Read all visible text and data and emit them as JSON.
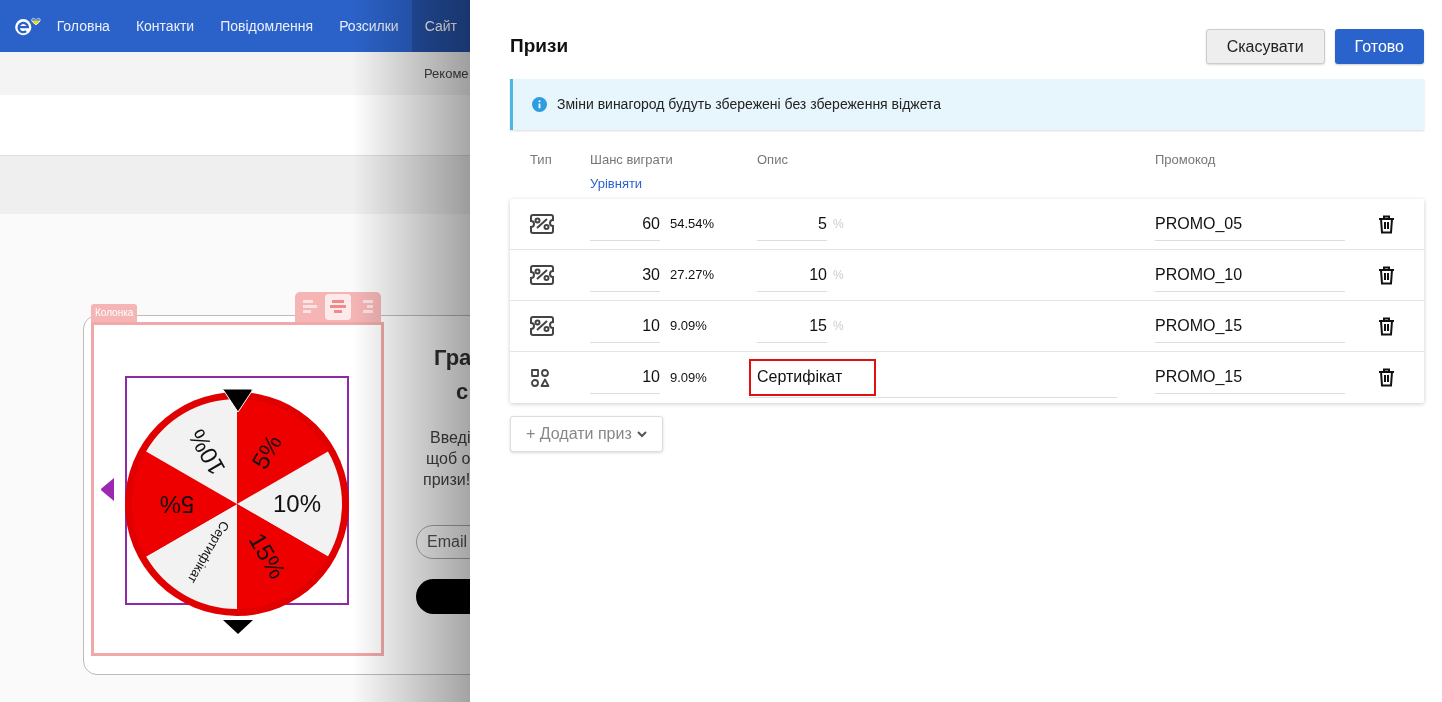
{
  "nav": {
    "items": [
      {
        "label": "Головна",
        "selected": false
      },
      {
        "label": "Контакти",
        "selected": false
      },
      {
        "label": "Повідомлення",
        "selected": false
      },
      {
        "label": "Розсилки",
        "selected": false
      },
      {
        "label": "Сайт",
        "selected": true
      }
    ]
  },
  "subbar": {
    "text": "Рекоме"
  },
  "canvas": {
    "column_tag": "Колонка",
    "align_buttons": [
      {
        "selected": false
      },
      {
        "selected": true
      },
      {
        "selected": false
      }
    ],
    "wheel": {
      "segments": [
        {
          "label": "5%",
          "color": "#ee0000"
        },
        {
          "label": "10%",
          "color": "#f2f2f2"
        },
        {
          "label": "15%",
          "color": "#ee0000"
        },
        {
          "label": "Сертифікат",
          "color": "#f2f2f2"
        },
        {
          "label": "5%",
          "color": "#ee0000"
        },
        {
          "label": "10%",
          "color": "#f2f2f2"
        }
      ]
    },
    "heading_lines": [
      "Гра",
      "с"
    ],
    "body_lines": [
      "Введі",
      "щоб о",
      "призи!"
    ],
    "email_placeholder": "Email"
  },
  "panel": {
    "title": "Призи",
    "buttons": [
      {
        "label": "Скасувати",
        "kind": "secondary"
      },
      {
        "label": "Готово",
        "kind": "primary"
      }
    ],
    "notice": "Зміни винагород будуть збережені без збереження віджета",
    "columns": [
      "Тип",
      "Шанс виграти",
      "Опис",
      "Промокод"
    ],
    "equalize_link": "Урівняти",
    "prizes": [
      {
        "kind": "discount",
        "chance": "60",
        "share": "54.54%",
        "description": "5",
        "unit": "%",
        "promo": "PROMO_05",
        "highlighted": false
      },
      {
        "kind": "discount",
        "chance": "30",
        "share": "27.27%",
        "description": "10",
        "unit": "%",
        "promo": "PROMO_10",
        "highlighted": false
      },
      {
        "kind": "discount",
        "chance": "10",
        "share": "9.09%",
        "description": "15",
        "unit": "%",
        "promo": "PROMO_15",
        "highlighted": false
      },
      {
        "kind": "gift",
        "chance": "10",
        "share": "9.09%",
        "description": "Сертифікат",
        "promo": "PROMO_15",
        "highlighted": true
      }
    ],
    "add_button": "+ Додати приз"
  }
}
